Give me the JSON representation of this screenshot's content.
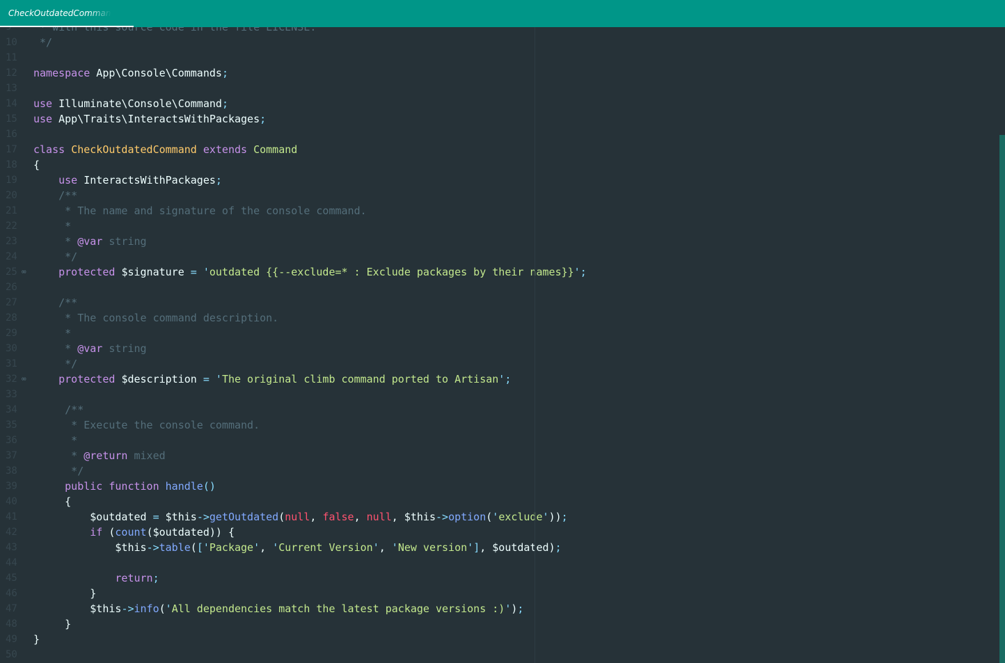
{
  "tab": {
    "label": "CheckOutdatedCommand"
  },
  "colors": {
    "tab_bar": "#009688",
    "editor_bg": "#263238",
    "keyword": "#c792ea",
    "class_name": "#ffcb6b",
    "string": "#c3e88d",
    "punctuation": "#89ddff",
    "function": "#82aaff",
    "literal": "#ff5370",
    "comment": "#546e7a"
  },
  "gutter_icon": "link-icon",
  "lines": [
    {
      "n": "9",
      "tokens": [
        [
          "c",
          " * with this source code in the file LICENSE."
        ]
      ]
    },
    {
      "n": "10",
      "tokens": [
        [
          "c",
          " */"
        ]
      ]
    },
    {
      "n": "11",
      "tokens": []
    },
    {
      "n": "12",
      "tokens": [
        [
          "k",
          "namespace"
        ],
        [
          "t",
          " App\\Console\\Commands"
        ],
        [
          "p",
          ";"
        ]
      ]
    },
    {
      "n": "13",
      "tokens": []
    },
    {
      "n": "14",
      "tokens": [
        [
          "k",
          "use"
        ],
        [
          "t",
          " Illuminate\\Console\\Command"
        ],
        [
          "p",
          ";"
        ]
      ]
    },
    {
      "n": "15",
      "tokens": [
        [
          "k",
          "use"
        ],
        [
          "t",
          " App\\Traits\\InteractsWithPackages"
        ],
        [
          "p",
          ";"
        ]
      ]
    },
    {
      "n": "16",
      "tokens": []
    },
    {
      "n": "17",
      "tokens": [
        [
          "k",
          "class"
        ],
        [
          "t",
          " "
        ],
        [
          "cl",
          "CheckOutdatedCommand"
        ],
        [
          "t",
          " "
        ],
        [
          "k",
          "extends"
        ],
        [
          "t",
          " "
        ],
        [
          "s",
          "Command"
        ]
      ]
    },
    {
      "n": "18",
      "tokens": [
        [
          "t",
          "{"
        ]
      ]
    },
    {
      "n": "19",
      "tokens": [
        [
          "t",
          "    "
        ],
        [
          "k",
          "use"
        ],
        [
          "t",
          " InteractsWithPackages"
        ],
        [
          "p",
          ";"
        ]
      ]
    },
    {
      "n": "20",
      "tokens": [
        [
          "c",
          "    /**"
        ]
      ]
    },
    {
      "n": "21",
      "tokens": [
        [
          "c",
          "     * The name and signature of the console command."
        ]
      ]
    },
    {
      "n": "22",
      "tokens": [
        [
          "c",
          "     *"
        ]
      ]
    },
    {
      "n": "23",
      "tokens": [
        [
          "c",
          "     * "
        ],
        [
          "tag",
          "@var"
        ],
        [
          "c",
          " string"
        ]
      ]
    },
    {
      "n": "24",
      "tokens": [
        [
          "c",
          "     */"
        ]
      ]
    },
    {
      "n": "25",
      "icon": true,
      "tokens": [
        [
          "t",
          "    "
        ],
        [
          "k",
          "protected"
        ],
        [
          "t",
          " "
        ],
        [
          "v",
          "$signature"
        ],
        [
          "t",
          " "
        ],
        [
          "p",
          "="
        ],
        [
          "t",
          " "
        ],
        [
          "p",
          "'"
        ],
        [
          "s",
          "outdated {{--exclude=* : Exclude packages by their names}}"
        ],
        [
          "p",
          "'"
        ],
        [
          "p",
          ";"
        ]
      ]
    },
    {
      "n": "26",
      "tokens": []
    },
    {
      "n": "27",
      "tokens": [
        [
          "c",
          "    /**"
        ]
      ]
    },
    {
      "n": "28",
      "tokens": [
        [
          "c",
          "     * The console command description."
        ]
      ]
    },
    {
      "n": "29",
      "tokens": [
        [
          "c",
          "     *"
        ]
      ]
    },
    {
      "n": "30",
      "tokens": [
        [
          "c",
          "     * "
        ],
        [
          "tag",
          "@var"
        ],
        [
          "c",
          " string"
        ]
      ]
    },
    {
      "n": "31",
      "tokens": [
        [
          "c",
          "     */"
        ]
      ]
    },
    {
      "n": "32",
      "icon": true,
      "tokens": [
        [
          "t",
          "    "
        ],
        [
          "k",
          "protected"
        ],
        [
          "t",
          " "
        ],
        [
          "v",
          "$description"
        ],
        [
          "t",
          " "
        ],
        [
          "p",
          "="
        ],
        [
          "t",
          " "
        ],
        [
          "p",
          "'"
        ],
        [
          "s",
          "The original climb command ported to Artisan"
        ],
        [
          "p",
          "'"
        ],
        [
          "p",
          ";"
        ]
      ]
    },
    {
      "n": "33",
      "tokens": []
    },
    {
      "n": "34",
      "tokens": [
        [
          "c",
          "     /**"
        ]
      ]
    },
    {
      "n": "35",
      "tokens": [
        [
          "c",
          "      * Execute the console command."
        ]
      ]
    },
    {
      "n": "36",
      "tokens": [
        [
          "c",
          "      *"
        ]
      ]
    },
    {
      "n": "37",
      "tokens": [
        [
          "c",
          "      * "
        ],
        [
          "tag",
          "@return"
        ],
        [
          "c",
          " mixed"
        ]
      ]
    },
    {
      "n": "38",
      "tokens": [
        [
          "c",
          "      */"
        ]
      ]
    },
    {
      "n": "39",
      "tokens": [
        [
          "t",
          "     "
        ],
        [
          "k",
          "public"
        ],
        [
          "t",
          " "
        ],
        [
          "k",
          "function"
        ],
        [
          "t",
          " "
        ],
        [
          "f",
          "handle"
        ],
        [
          "p",
          "()"
        ]
      ]
    },
    {
      "n": "40",
      "tokens": [
        [
          "t",
          "     {"
        ]
      ]
    },
    {
      "n": "41",
      "tokens": [
        [
          "t",
          "         "
        ],
        [
          "v",
          "$outdated"
        ],
        [
          "t",
          " "
        ],
        [
          "p",
          "="
        ],
        [
          "t",
          " "
        ],
        [
          "v",
          "$this"
        ],
        [
          "p",
          "->"
        ],
        [
          "f",
          "getOutdated"
        ],
        [
          "t",
          "("
        ],
        [
          "n",
          "null"
        ],
        [
          "t",
          ", "
        ],
        [
          "n",
          "false"
        ],
        [
          "t",
          ", "
        ],
        [
          "n",
          "null"
        ],
        [
          "t",
          ", "
        ],
        [
          "v",
          "$this"
        ],
        [
          "p",
          "->"
        ],
        [
          "f",
          "option"
        ],
        [
          "t",
          "("
        ],
        [
          "p",
          "'"
        ],
        [
          "s",
          "exclude"
        ],
        [
          "p",
          "'"
        ],
        [
          "t",
          "))"
        ],
        [
          "p",
          ";"
        ]
      ]
    },
    {
      "n": "42",
      "tokens": [
        [
          "t",
          "         "
        ],
        [
          "k",
          "if"
        ],
        [
          "t",
          " ("
        ],
        [
          "f",
          "count"
        ],
        [
          "t",
          "("
        ],
        [
          "v",
          "$outdated"
        ],
        [
          "t",
          ")) {"
        ]
      ]
    },
    {
      "n": "43",
      "tokens": [
        [
          "t",
          "             "
        ],
        [
          "v",
          "$this"
        ],
        [
          "p",
          "->"
        ],
        [
          "f",
          "table"
        ],
        [
          "t",
          "("
        ],
        [
          "p",
          "["
        ],
        [
          "p",
          "'"
        ],
        [
          "s",
          "Package"
        ],
        [
          "p",
          "'"
        ],
        [
          "t",
          ", "
        ],
        [
          "p",
          "'"
        ],
        [
          "s",
          "Current Version"
        ],
        [
          "p",
          "'"
        ],
        [
          "t",
          ", "
        ],
        [
          "p",
          "'"
        ],
        [
          "s",
          "New version"
        ],
        [
          "p",
          "'"
        ],
        [
          "p",
          "]"
        ],
        [
          "t",
          ", "
        ],
        [
          "v",
          "$outdated"
        ],
        [
          "t",
          ")"
        ],
        [
          "p",
          ";"
        ]
      ]
    },
    {
      "n": "44",
      "tokens": []
    },
    {
      "n": "45",
      "tokens": [
        [
          "t",
          "             "
        ],
        [
          "k",
          "return"
        ],
        [
          "p",
          ";"
        ]
      ]
    },
    {
      "n": "46",
      "tokens": [
        [
          "t",
          "         }"
        ]
      ]
    },
    {
      "n": "47",
      "tokens": [
        [
          "t",
          "         "
        ],
        [
          "v",
          "$this"
        ],
        [
          "p",
          "->"
        ],
        [
          "f",
          "info"
        ],
        [
          "t",
          "("
        ],
        [
          "p",
          "'"
        ],
        [
          "s",
          "All dependencies match the latest package versions :)"
        ],
        [
          "p",
          "'"
        ],
        [
          "t",
          ")"
        ],
        [
          "p",
          ";"
        ]
      ]
    },
    {
      "n": "48",
      "tokens": [
        [
          "t",
          "     }"
        ]
      ]
    },
    {
      "n": "49",
      "tokens": [
        [
          "t",
          "}"
        ]
      ]
    },
    {
      "n": "50",
      "tokens": []
    }
  ]
}
